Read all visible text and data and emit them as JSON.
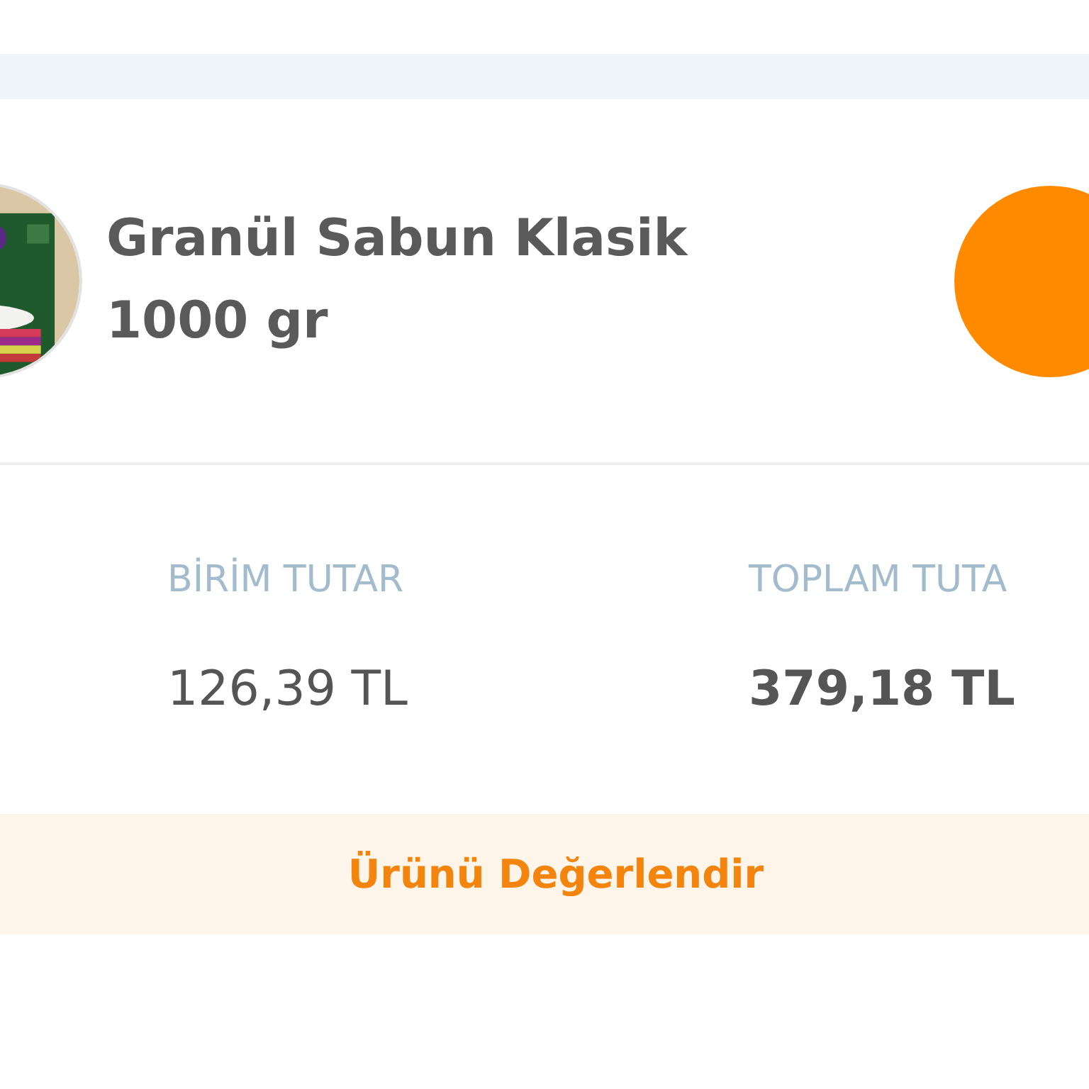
{
  "product": {
    "title": "Granül Sabun Klasik 1000 gr"
  },
  "prices": [
    {
      "label": "BİRİM TUTAR",
      "value": "126,39 TL",
      "emphasis": false
    },
    {
      "label": "TOPLAM TUTA",
      "value": "379,18 TL",
      "emphasis": true
    }
  ],
  "review_button": {
    "label": "Ürünü Değerlendir"
  }
}
